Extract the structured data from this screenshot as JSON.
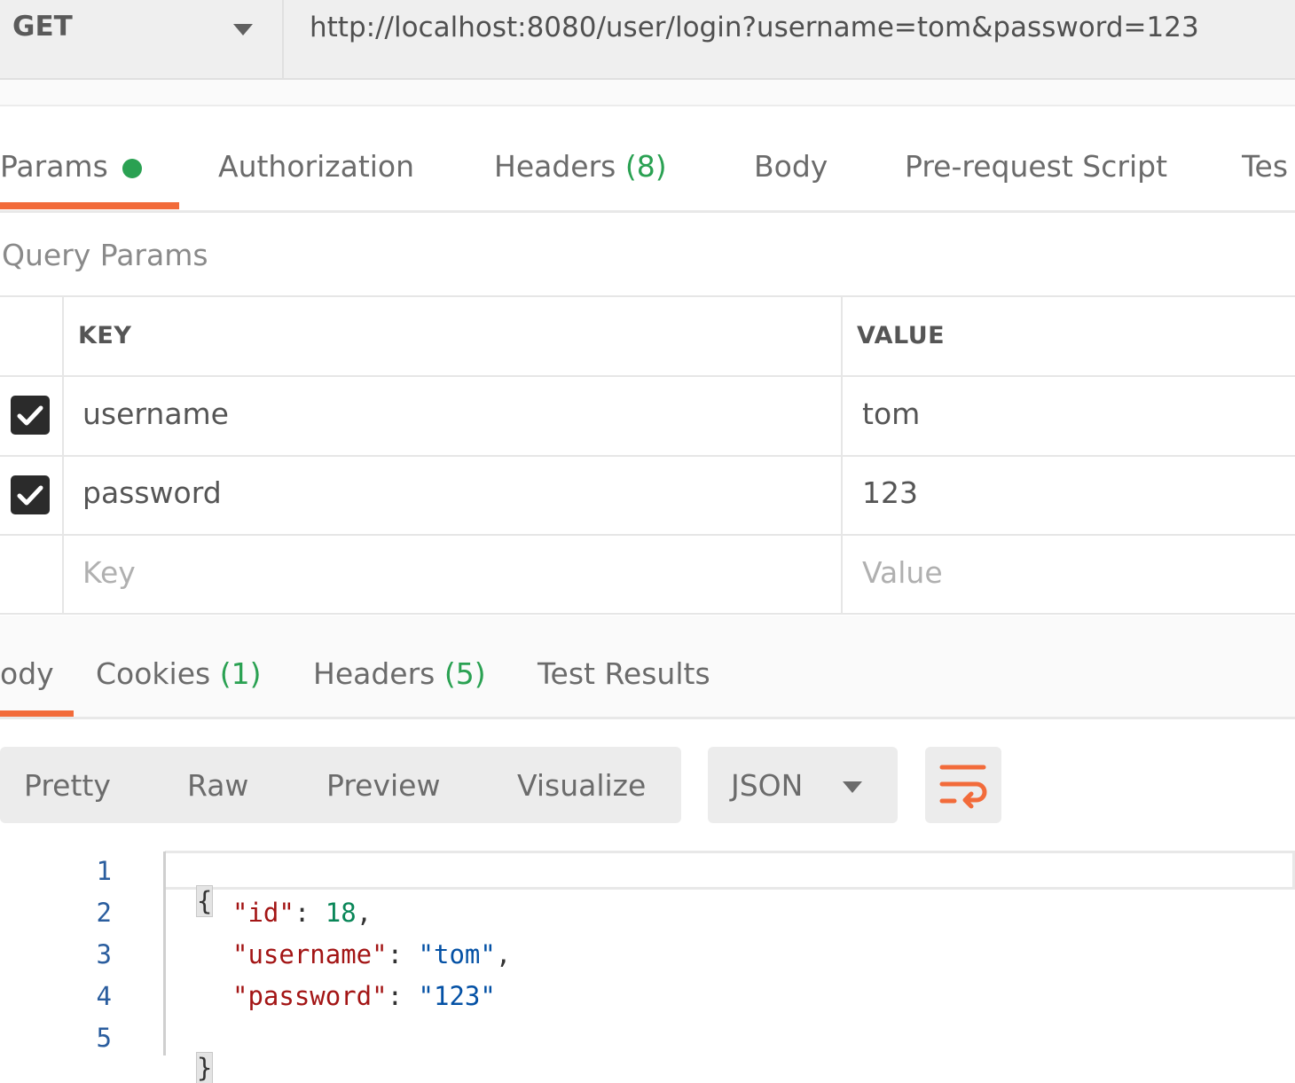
{
  "request": {
    "method": "GET",
    "url": "http://localhost:8080/user/login?username=tom&password=123"
  },
  "request_tabs": [
    {
      "label": "Params",
      "active": true
    },
    {
      "label": "Authorization"
    },
    {
      "label": "Headers",
      "count": "(8)"
    },
    {
      "label": "Body"
    },
    {
      "label": "Pre-request Script"
    },
    {
      "label": "Tes"
    }
  ],
  "query_params": {
    "title": "Query Params",
    "headers": {
      "key": "KEY",
      "value": "VALUE"
    },
    "rows": [
      {
        "key": "username",
        "value": "tom",
        "checked": true
      },
      {
        "key": "password",
        "value": "123",
        "checked": true
      }
    ],
    "placeholder": {
      "key": "Key",
      "value": "Value"
    }
  },
  "response_tabs": [
    {
      "label": "ody",
      "active": true
    },
    {
      "label": "Cookies",
      "count": "(1)"
    },
    {
      "label": "Headers",
      "count": "(5)"
    },
    {
      "label": "Test Results"
    }
  ],
  "view_modes": [
    "Pretty",
    "Raw",
    "Preview",
    "Visualize"
  ],
  "format": "JSON",
  "code": {
    "line_numbers": [
      "1",
      "2",
      "3",
      "4",
      "5"
    ],
    "open_brace": "{",
    "close_brace": "}",
    "entries": [
      {
        "key": "\"id\"",
        "sep": ": ",
        "value": "18",
        "trail": ",",
        "type": "number"
      },
      {
        "key": "\"username\"",
        "sep": ": ",
        "value": "\"tom\"",
        "trail": ",",
        "type": "string"
      },
      {
        "key": "\"password\"",
        "sep": ": ",
        "value": "\"123\"",
        "trail": "",
        "type": "string"
      }
    ]
  },
  "colors": {
    "accent": "#f26b3a",
    "count_green": "#2aa152",
    "json_key": "#a31515",
    "json_number": "#098658",
    "json_string": "#0451a5",
    "line_number": "#2a5d9e"
  }
}
